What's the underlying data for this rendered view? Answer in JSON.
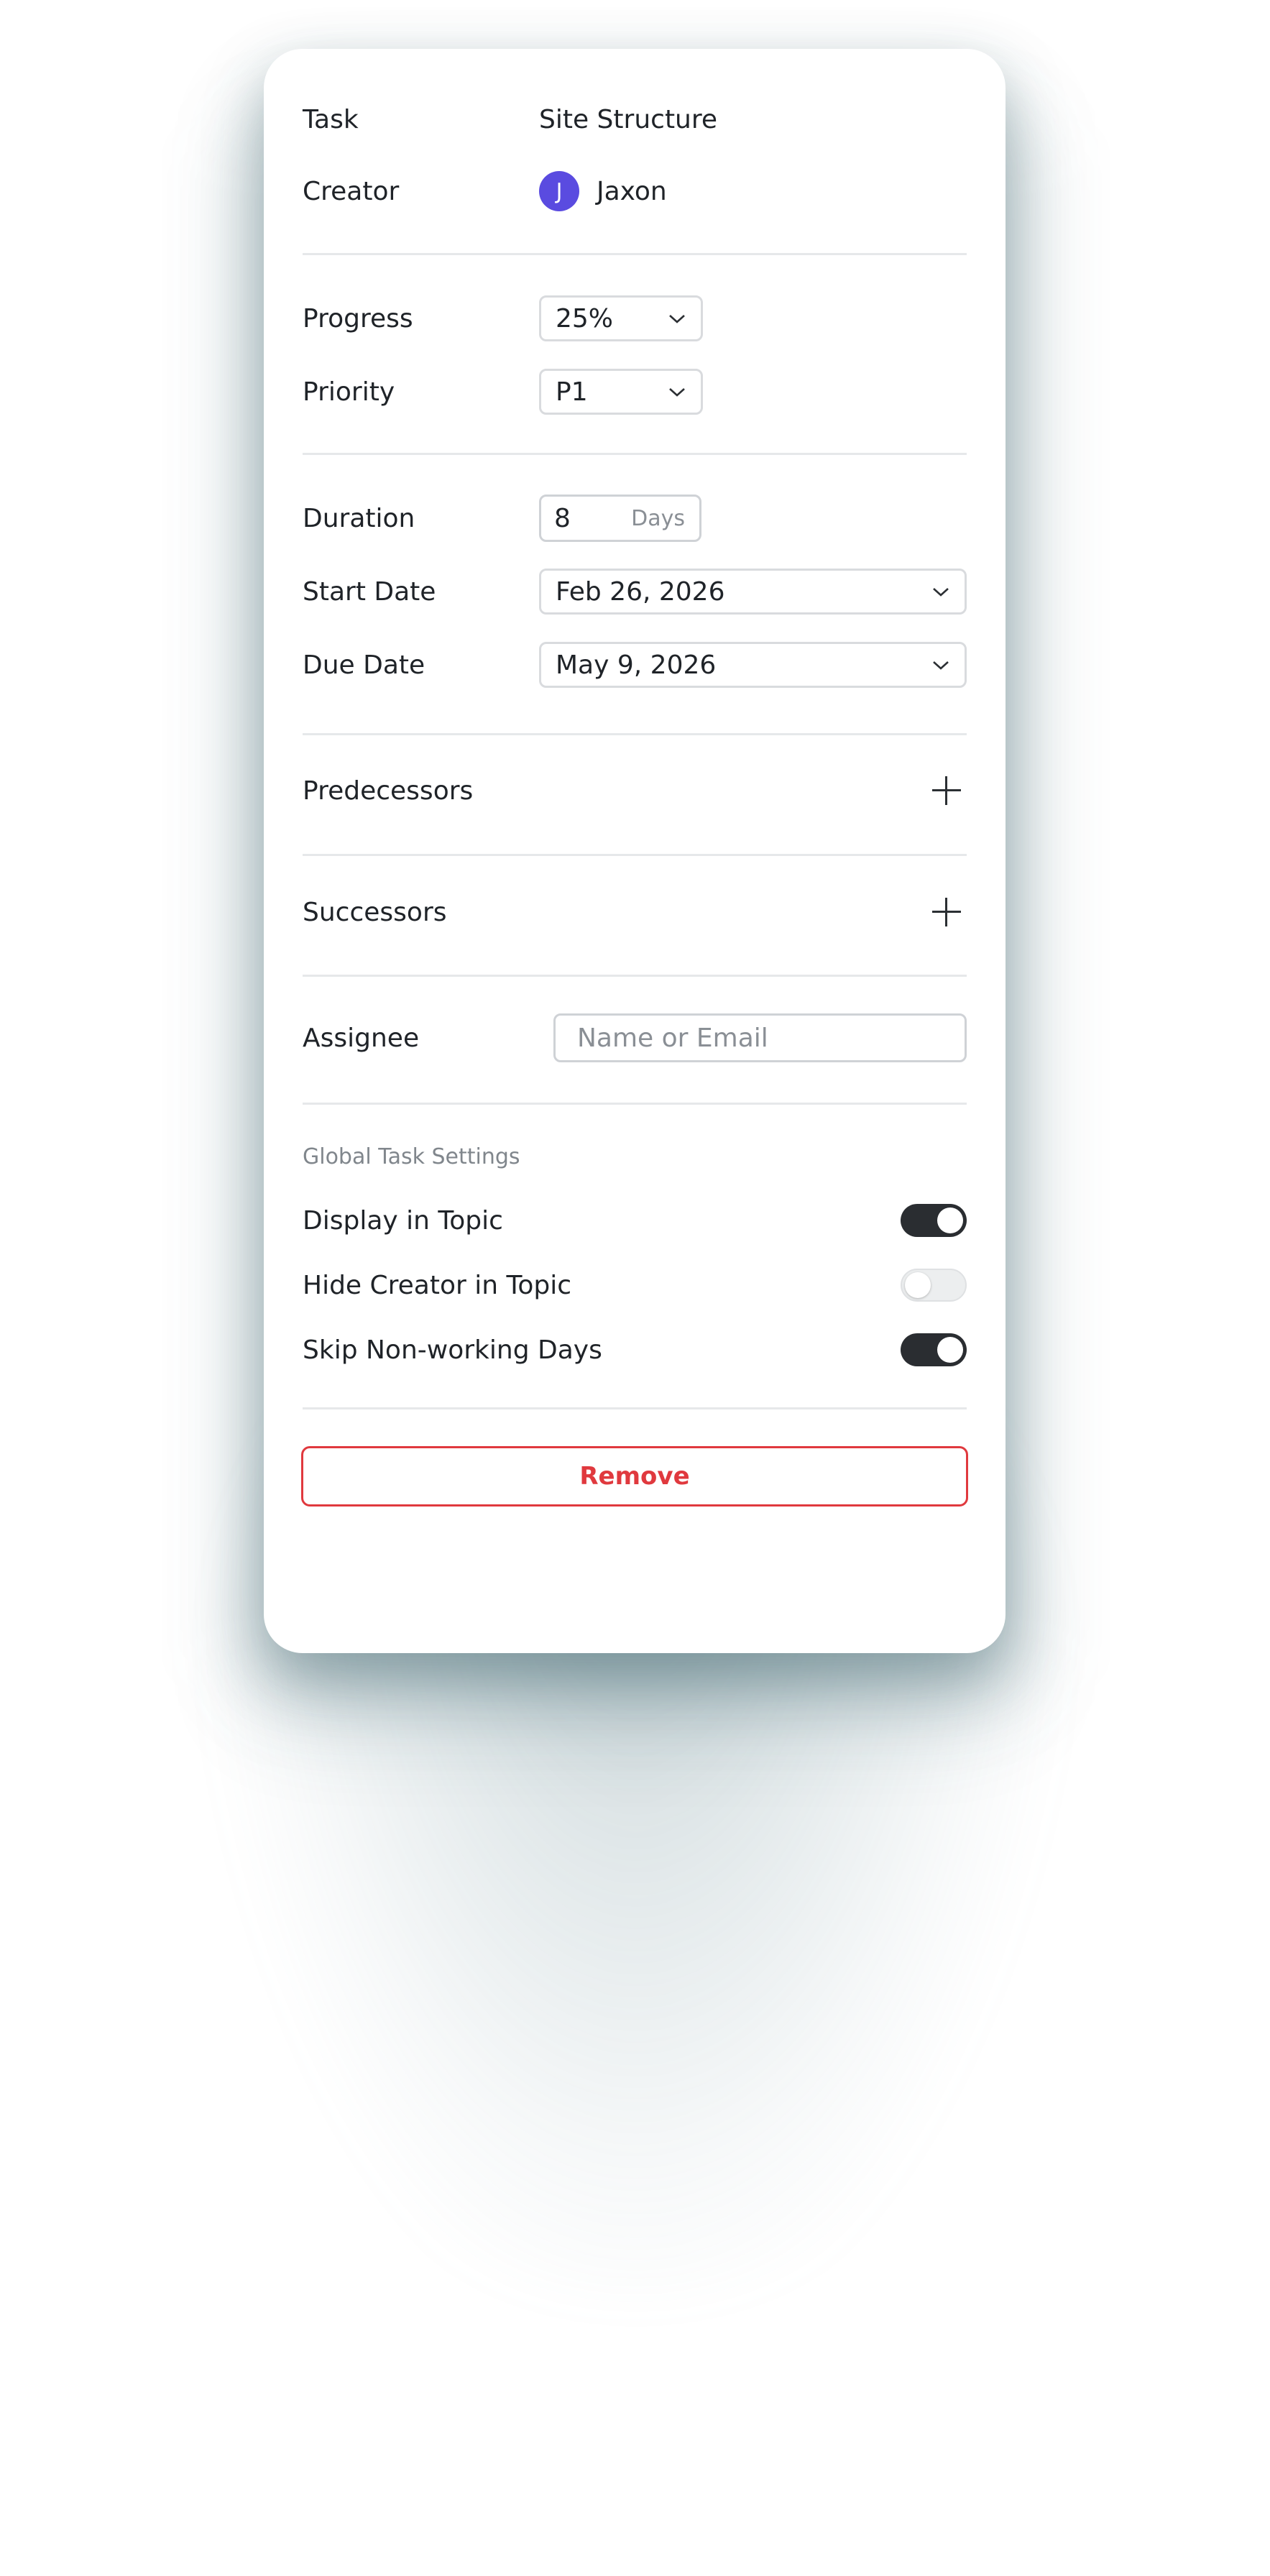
{
  "task": {
    "label": "Task",
    "value": "Site Structure"
  },
  "creator": {
    "label": "Creator",
    "initial": "J",
    "name": "Jaxon",
    "avatar_color": "#5a4be0"
  },
  "progress": {
    "label": "Progress",
    "value": "25%"
  },
  "priority": {
    "label": "Priority",
    "value": "P1"
  },
  "duration": {
    "label": "Duration",
    "value": "8",
    "unit": "Days"
  },
  "start_date": {
    "label": "Start Date",
    "value": "Feb 26, 2026"
  },
  "due_date": {
    "label": "Due Date",
    "value": "May 9, 2026"
  },
  "predecessors": {
    "label": "Predecessors"
  },
  "successors": {
    "label": "Successors"
  },
  "assignee": {
    "label": "Assignee",
    "placeholder": "Name or Email"
  },
  "global_settings": {
    "title": "Global Task Settings",
    "items": [
      {
        "label": "Display in Topic",
        "enabled": true
      },
      {
        "label": "Hide Creator in Topic",
        "enabled": false
      },
      {
        "label": "Skip Non-working Days",
        "enabled": true
      }
    ]
  },
  "remove": {
    "label": "Remove",
    "color": "#e0393e"
  }
}
